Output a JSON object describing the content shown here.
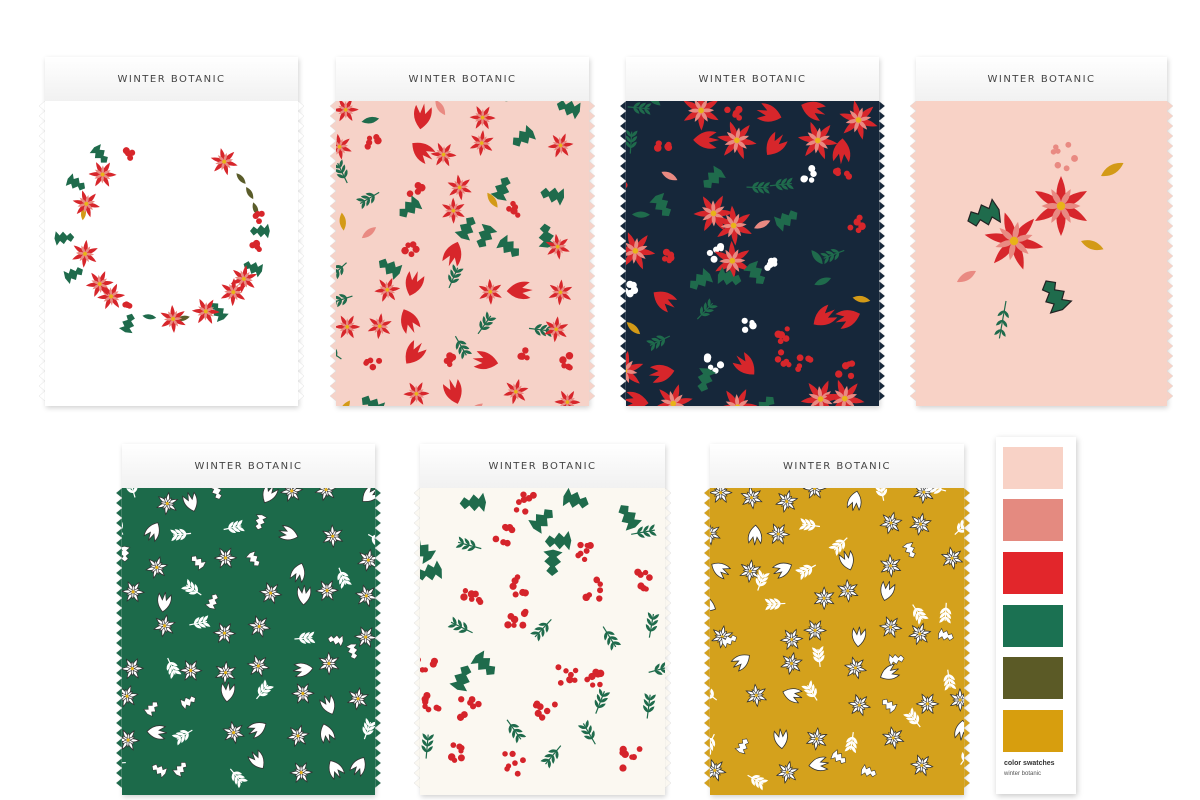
{
  "swatches": [
    {
      "label": "WINTER BOTANIC",
      "background": "#ffffff",
      "pattern": "wreath"
    },
    {
      "label": "WINTER BOTANIC",
      "background": "#f6d2c8",
      "pattern": "floral-color"
    },
    {
      "label": "WINTER BOTANIC",
      "background": "#16273a",
      "pattern": "floral-color"
    },
    {
      "label": "WINTER BOTANIC",
      "background": "#f8d2c6",
      "pattern": "bouquet"
    },
    {
      "label": "WINTER BOTANIC",
      "background": "#1c6a4a",
      "pattern": "poinsettia-outline"
    },
    {
      "label": "WINTER BOTANIC",
      "background": "#fbf8f1",
      "pattern": "holly-berries"
    },
    {
      "label": "WINTER BOTANIC",
      "background": "#d4a11c",
      "pattern": "poinsettia-outline"
    }
  ],
  "palette": {
    "colors": [
      "#f8d2c6",
      "#e48a80",
      "#e2262b",
      "#1b7152",
      "#5b5a26",
      "#d79e0e"
    ],
    "title": "color swatches",
    "subtitle": "winter botanic"
  },
  "icons": [
    "poinsettia-icon",
    "holly-leaf-icon",
    "berry-cluster-icon",
    "leaf-sprig-icon"
  ]
}
